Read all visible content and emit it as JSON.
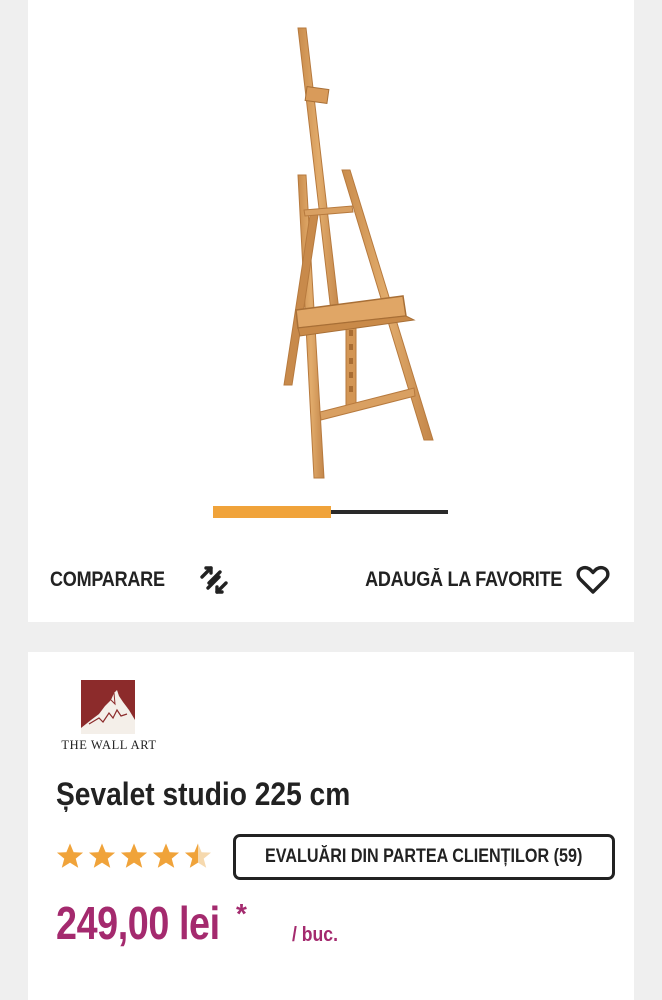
{
  "gallery": {
    "image_alt": "Șevalet studio 225 cm",
    "progress": 0.5
  },
  "actions": {
    "compare_label": "COMPARARE",
    "compare_icon": "compare-arrows-icon",
    "favorite_label": "ADAUGĂ LA FAVORITE",
    "favorite_icon": "heart-icon"
  },
  "brand": {
    "name": "THE WALL ART",
    "logo_color": "#8c2b2b"
  },
  "product": {
    "title": "Șevalet studio 225 cm",
    "rating": 4.5,
    "rating_max": 5,
    "star_color": "#f0a33a",
    "reviews_label": "EVALUĂRI DIN PARTEA CLIENȚILOR (59)",
    "price": "249,00 lei",
    "price_asterisk": "*",
    "price_unit": "/ buc.",
    "price_color": "#a42a6e"
  },
  "colors": {
    "accent": "#f0a33a",
    "background": "#efefef",
    "card": "#ffffff"
  }
}
